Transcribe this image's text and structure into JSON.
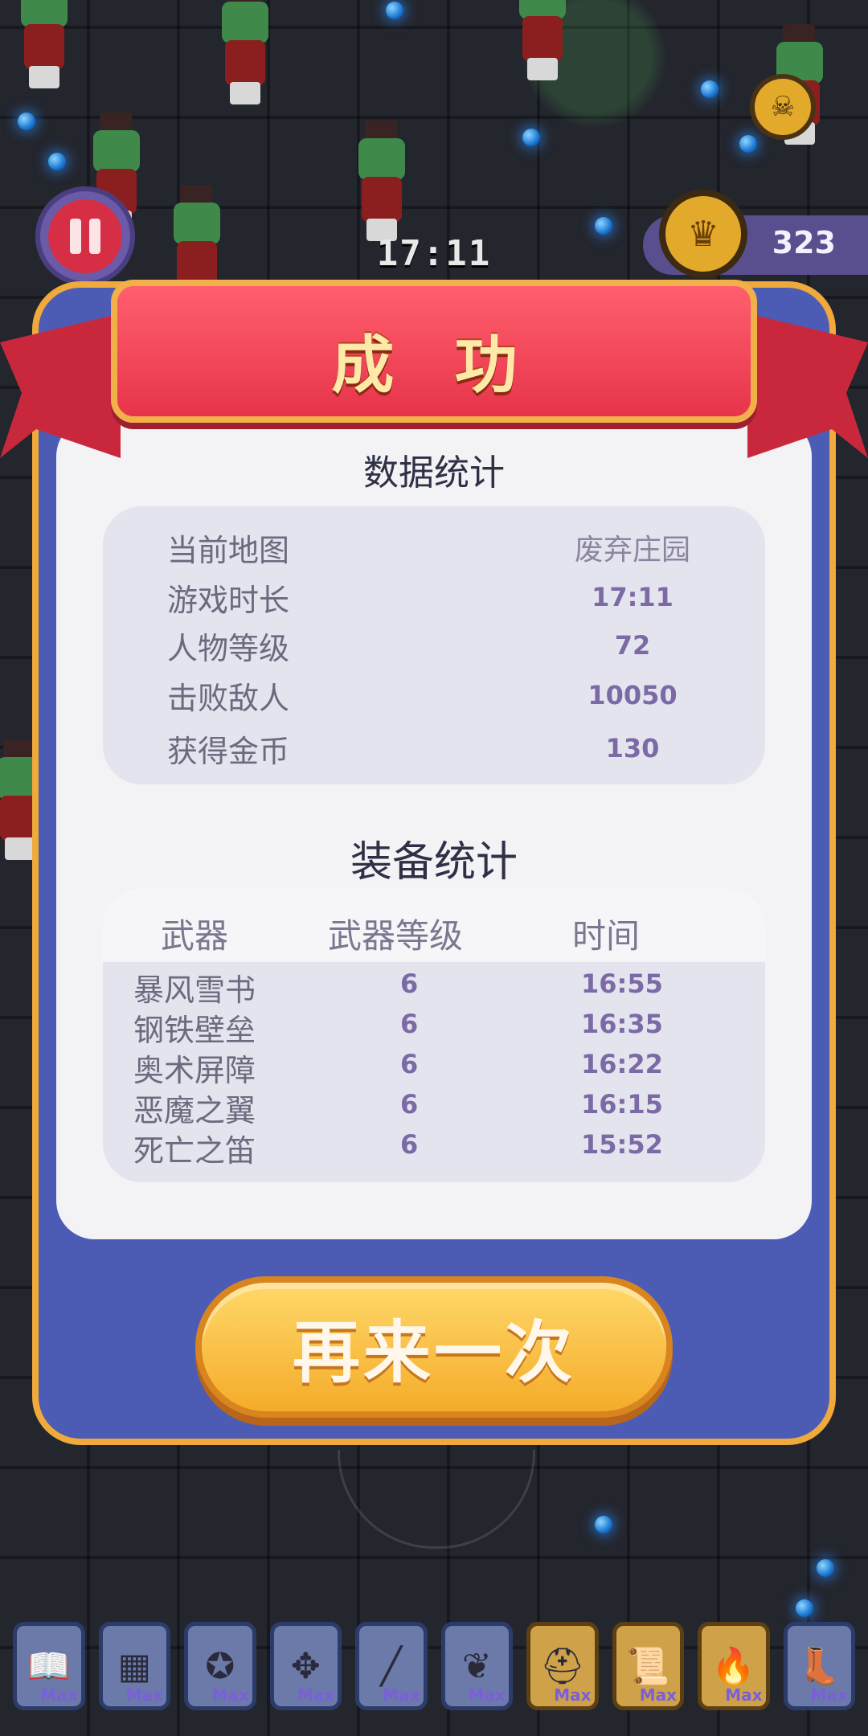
{
  "hud": {
    "timer": "17:11",
    "coins": "323"
  },
  "dialog": {
    "title": "成 功",
    "stats_title": "数据统计",
    "stats": [
      {
        "label": "当前地图",
        "value": "废弃庄园"
      },
      {
        "label": "游戏时长",
        "value": "17:11"
      },
      {
        "label": "人物等级",
        "value": "72"
      },
      {
        "label": "击败敌人",
        "value": "10050"
      },
      {
        "label": "获得金币",
        "value": "130"
      }
    ],
    "equipment_title": "装备统计",
    "equipment_headers": {
      "weapon": "武器",
      "level": "武器等级",
      "time": "时间"
    },
    "equipment": [
      {
        "name": "暴风雪书",
        "level": "6",
        "time": "16:55"
      },
      {
        "name": "钢铁壁垒",
        "level": "6",
        "time": "16:35"
      },
      {
        "name": "奥术屏障",
        "level": "6",
        "time": "16:22"
      },
      {
        "name": "恶魔之翼",
        "level": "6",
        "time": "16:15"
      },
      {
        "name": "死亡之笛",
        "level": "6",
        "time": "15:52"
      }
    ],
    "retry_label": "再来一次"
  },
  "inventory": [
    {
      "icon": "book-icon",
      "glyph": "📖",
      "max": "Max"
    },
    {
      "icon": "stone-tablet-icon",
      "glyph": "▦",
      "max": "Max"
    },
    {
      "icon": "amulet-icon",
      "glyph": "✪",
      "max": "Max"
    },
    {
      "icon": "demon-wings-icon",
      "glyph": "✥",
      "max": "Max"
    },
    {
      "icon": "flute-icon",
      "glyph": "╱",
      "max": "Max"
    },
    {
      "icon": "wings-icon",
      "glyph": "❦",
      "max": "Max"
    },
    {
      "icon": "helmet-icon",
      "glyph": "⛑",
      "max": "Max"
    },
    {
      "icon": "scroll-icon",
      "glyph": "📜",
      "max": "Max"
    },
    {
      "icon": "torch-icon",
      "glyph": "🔥",
      "max": "Max"
    },
    {
      "icon": "boot-icon",
      "glyph": "👢",
      "max": "Max"
    }
  ],
  "colors": {
    "panel": "#4c5cb5",
    "ribbon": "#e7344a",
    "button": "#f4ac2a"
  }
}
